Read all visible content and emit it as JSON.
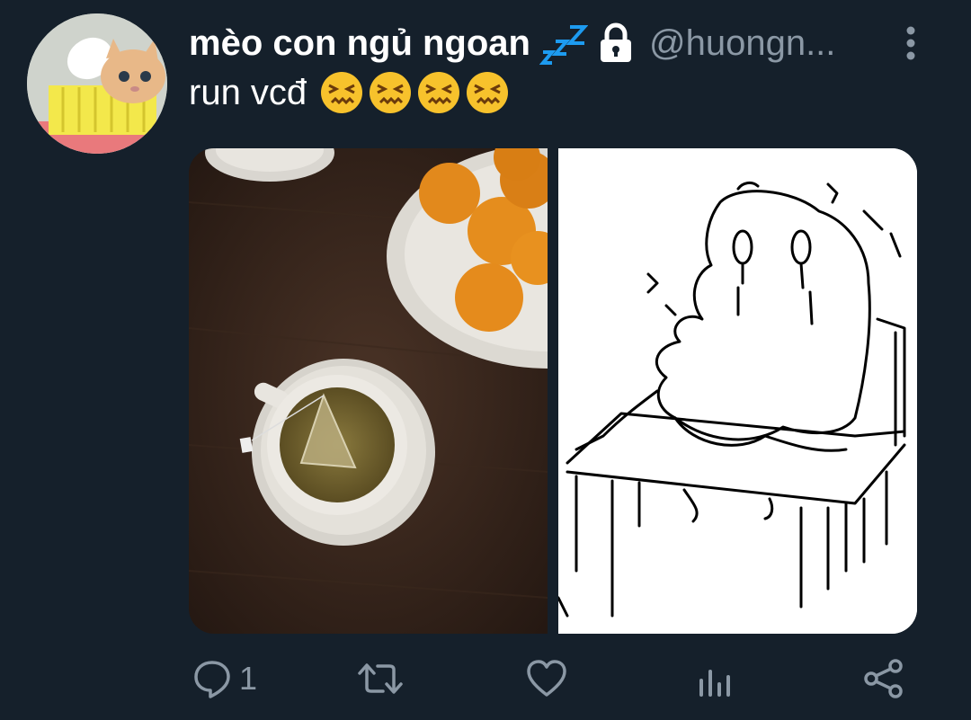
{
  "tweet": {
    "display_name": "mèo con ngủ ngoan",
    "name_emoji": "zzz-icon",
    "handle": "@huongn...",
    "text": "run vcđ",
    "emoji_count": 4,
    "emoji": "confounded-face"
  },
  "media": {
    "left_photo": "tea cup with oranges on dark table",
    "right_photo": "line drawing of melting figure at table"
  },
  "actions": {
    "reply_count": "1",
    "icons": [
      "reply-icon",
      "retweet-icon",
      "like-icon",
      "stats-icon",
      "share-icon"
    ]
  },
  "colors": {
    "background": "#15202b",
    "secondary_text": "#8b98a5",
    "zzz_blue": "#1d9bf0"
  }
}
